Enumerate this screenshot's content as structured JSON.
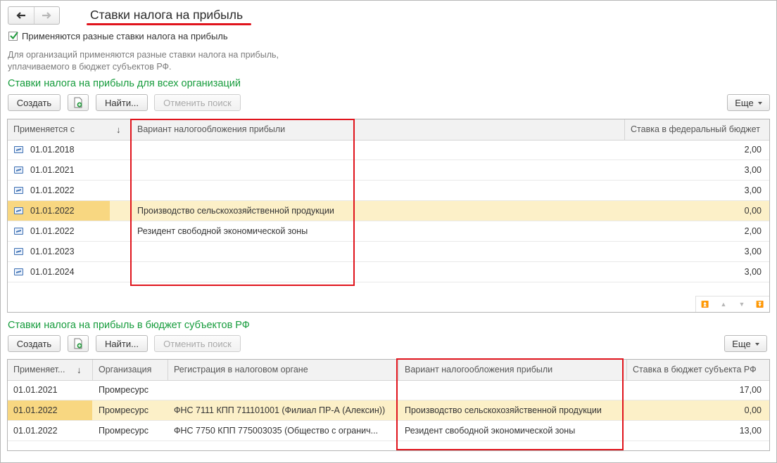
{
  "window": {
    "title": "Ставки налога на прибыль",
    "back_icon": "arrow-left-icon",
    "forward_icon": "arrow-right-icon"
  },
  "option": {
    "checkbox_label": "Применяются разные ставки налога на прибыль",
    "checked": true
  },
  "note": {
    "line1": "Для организаций применяются разные ставки налога на прибыль,",
    "line2": "уплачиваемого в бюджет субъектов РФ."
  },
  "section_all": {
    "title": "Ставки налога на прибыль для всех организаций",
    "toolbar": {
      "create": "Создать",
      "copy_icon": "add-copy-icon",
      "find": "Найти...",
      "cancel_search": "Отменить поиск",
      "more": "Еще"
    },
    "columns": [
      "Применяется с",
      "Вариант налогообложения прибыли",
      "Ставка в федеральный бюджет"
    ],
    "rows": [
      {
        "date": "01.01.2018",
        "variant": "",
        "rate": "2,00"
      },
      {
        "date": "01.01.2021",
        "variant": "",
        "rate": "3,00"
      },
      {
        "date": "01.01.2022",
        "variant": "",
        "rate": "3,00"
      },
      {
        "date": "01.01.2022",
        "variant": "Производство сельскохозяйственной продукции",
        "rate": "0,00",
        "selected": true
      },
      {
        "date": "01.01.2022",
        "variant": "Резидент свободной экономической зоны",
        "rate": "2,00"
      },
      {
        "date": "01.01.2023",
        "variant": "",
        "rate": "3,00"
      },
      {
        "date": "01.01.2024",
        "variant": "",
        "rate": "3,00"
      }
    ]
  },
  "section_regions": {
    "title": "Ставки налога на прибыль в бюджет субъектов РФ",
    "toolbar": {
      "create": "Создать",
      "copy_icon": "add-copy-icon",
      "find": "Найти...",
      "cancel_search": "Отменить поиск",
      "more": "Еще"
    },
    "columns": [
      "Применяет...",
      "Организация",
      "Регистрация в налоговом органе",
      "Вариант налогообложения прибыли",
      "Ставка в бюджет субъекта РФ"
    ],
    "rows": [
      {
        "date": "01.01.2021",
        "org": "Промресурс",
        "reg": "",
        "variant": "",
        "rate": "17,00"
      },
      {
        "date": "01.01.2022",
        "org": "Промресурс",
        "reg": "ФНС 7111 КПП 711101001 (Филиал ПР-А (Алексин))",
        "variant": "Производство сельскохозяйственной продукции",
        "rate": "0,00",
        "selected": true
      },
      {
        "date": "01.01.2022",
        "org": "Промресурс",
        "reg": "ФНС 7750 КПП 775003035 (Общество с огранич...",
        "variant": "Резидент свободной экономической зоны",
        "rate": "13,00"
      }
    ]
  },
  "colors": {
    "section_title": "#169c3c",
    "selected_row": "#fcf0c8",
    "selected_cell": "#f8d781",
    "highlight": "#e0141c"
  }
}
